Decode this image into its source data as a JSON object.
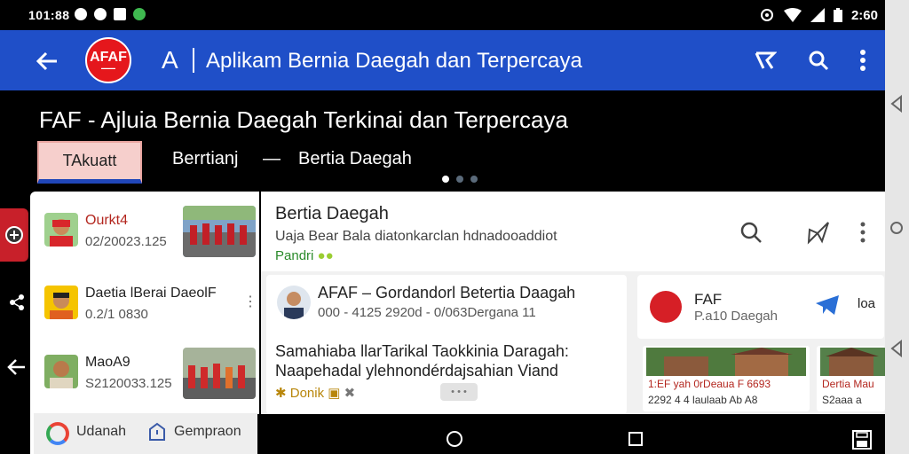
{
  "status_bar": {
    "time_left": "101:88",
    "time_right": "2:60"
  },
  "app_bar": {
    "logo_text": "AFAF",
    "translate_glyph": "A",
    "title": "Aplikam Bernia Daegah dan Terpercaya"
  },
  "hero": {
    "title": "FAF - Ajluia Bernia Daegah Terkinai dan Terpercaya",
    "chip_label": "TAkuatt",
    "link1": "Berrtianj",
    "separator": "—",
    "link2": "Bertia Daegah"
  },
  "list": {
    "items": [
      {
        "name": "Ourkt4",
        "date": "02/20023.125",
        "has_thumb": true
      },
      {
        "name": "Daetia lBerai DaeolF",
        "date": "0.2/1 0830",
        "has_thumb": false
      },
      {
        "name": "MaoA9",
        "date": "S2120033.125",
        "has_thumb": true
      }
    ],
    "footer_left": "Udanah",
    "footer_right": "Gempraon"
  },
  "main": {
    "title": "Bertia Daegah",
    "subtitle": "Uaja Bear Bala diatonkarclan hdnadooaddiot",
    "tag": "Pandri"
  },
  "post": {
    "title": "AFAF – Gordandorl Betertia Daagah",
    "meta": "000 - 4125 2920d   - 0/063Dergana 11",
    "body_line1": "Samahiaba llarTarikal Taokkinia Daragah:",
    "body_line2": "Naapehadal ylehnondérdajsahian Viand",
    "footer": "Donik",
    "pill": "• • •"
  },
  "side_card": {
    "name": "FAF",
    "subtitle": "P.a10 Daegah",
    "right_text": "loa"
  },
  "tiles": [
    {
      "line1": "1:EF yah 0rDeaua F 6693",
      "line2": "2292 4  4 laulaab Ab A8"
    },
    {
      "line1": "Dertia Mau",
      "line2": "S2aaa a"
    }
  ]
}
